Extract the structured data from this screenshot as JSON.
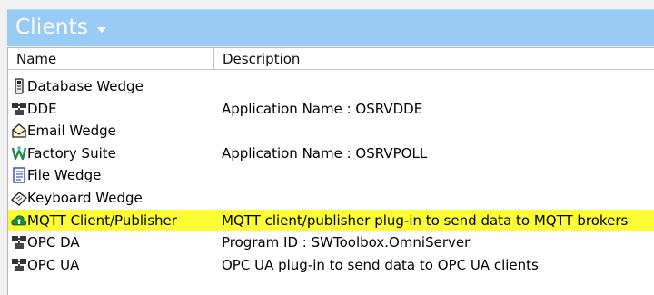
{
  "header": {
    "title": "Clients"
  },
  "columns": {
    "name": "Name",
    "description": "Description"
  },
  "rows": [
    {
      "name": "Database Wedge",
      "description": "",
      "icon": "database-wedge-icon"
    },
    {
      "name": "DDE",
      "description": "Application Name :  OSRVDDE",
      "icon": "dde-icon"
    },
    {
      "name": "Email Wedge",
      "description": "",
      "icon": "email-wedge-icon"
    },
    {
      "name": "Factory Suite",
      "description": "Application Name :  OSRVPOLL",
      "icon": "factory-suite-icon"
    },
    {
      "name": "File Wedge",
      "description": "",
      "icon": "file-wedge-icon"
    },
    {
      "name": "Keyboard Wedge",
      "description": "",
      "icon": "keyboard-wedge-icon"
    },
    {
      "name": "MQTT Client/Publisher",
      "description": "MQTT client/publisher plug-in to send data to MQTT brokers",
      "icon": "cloud-upload-icon",
      "highlighted": true
    },
    {
      "name": "OPC DA",
      "description": "Program ID :  SWToolbox.OmniServer",
      "icon": "opc-da-icon"
    },
    {
      "name": "OPC UA",
      "description": "OPC UA plug-in to send data to OPC UA clients",
      "icon": "opc-ua-icon"
    }
  ],
  "colors": {
    "header": "#99ccf4",
    "highlight": "#fbfc34"
  }
}
